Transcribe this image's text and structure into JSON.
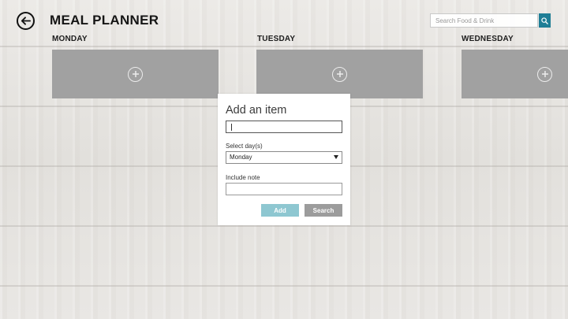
{
  "header": {
    "title": "MEAL PLANNER",
    "back_icon": "back-arrow-icon",
    "search": {
      "placeholder": "Search Food & Drink",
      "button_icon": "search-icon",
      "button_color": "#1f7e96"
    }
  },
  "days": [
    {
      "label": "MONDAY",
      "add_icon": "plus-circle-icon"
    },
    {
      "label": "TUESDAY",
      "add_icon": "plus-circle-icon"
    },
    {
      "label": "WEDNESDAY",
      "add_icon": "plus-circle-icon"
    }
  ],
  "colors": {
    "tile": "#a1a1a1",
    "add_button": "#8ec7d1",
    "search_button": "#9c9c9c"
  },
  "dialog": {
    "title": "Add an item",
    "item_value": "",
    "select_label": "Select day(s)",
    "selected_day": "Monday",
    "note_label": "Include note",
    "note_value": "",
    "add_label": "Add",
    "search_label": "Search"
  }
}
